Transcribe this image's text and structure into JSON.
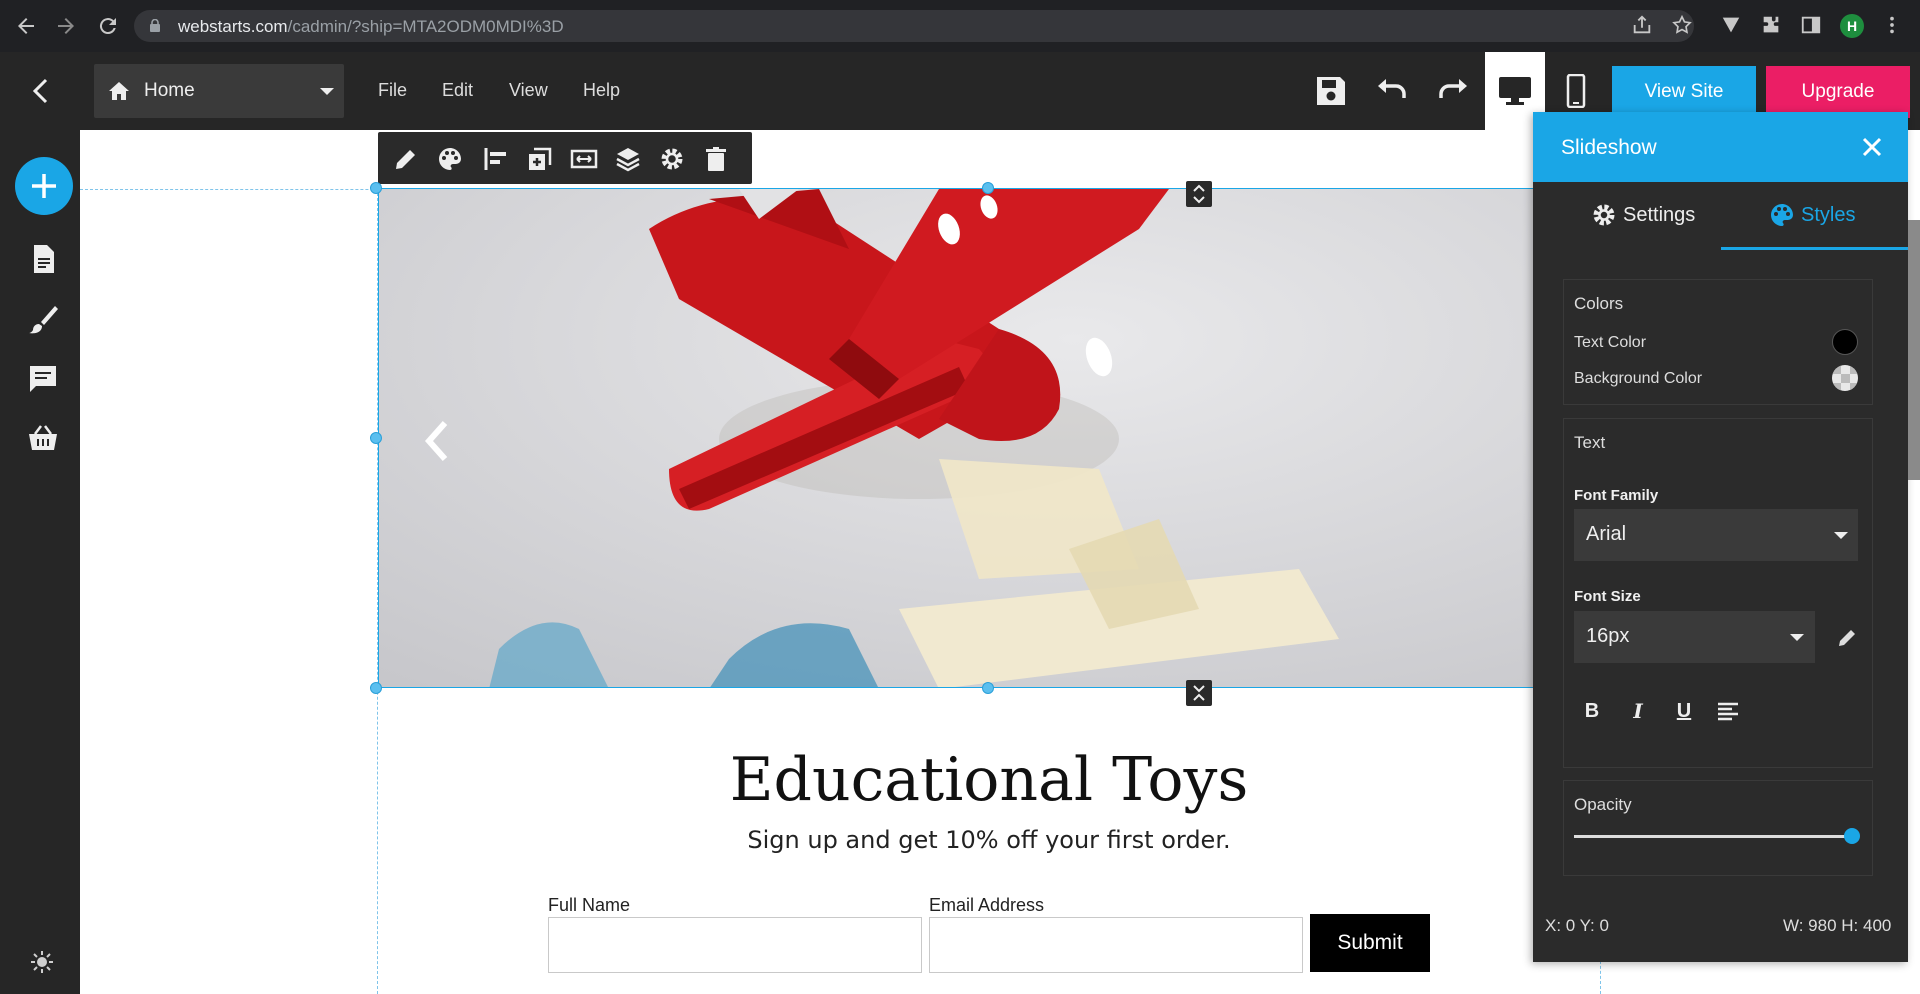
{
  "browser": {
    "url_host": "webstarts.com",
    "url_path": "/cadmin/?ship=MTA2ODM0MDI%3D",
    "avatar_letter": "H"
  },
  "toolbar": {
    "page_select": "Home",
    "menu": [
      "File",
      "Edit",
      "View",
      "Help"
    ],
    "view_site_label": "View Site",
    "upgrade_label": "Upgrade"
  },
  "canvas": {
    "heading": "Educational Toys",
    "subheading": "Sign up and get 10% off your first order.",
    "form": {
      "full_name_label": "Full Name",
      "full_name_value": "",
      "email_label": "Email Address",
      "email_value": "",
      "submit_label": "Submit"
    }
  },
  "panel": {
    "title": "Slideshow",
    "tabs": [
      {
        "label": "Settings",
        "icon": "gear-icon",
        "active": false
      },
      {
        "label": "Styles",
        "icon": "palette-icon",
        "active": true
      }
    ],
    "colors": {
      "title": "Colors",
      "text_color_label": "Text Color",
      "text_color_value": "#000000",
      "background_color_label": "Background Color",
      "background_color_value": "transparent"
    },
    "text": {
      "title": "Text",
      "font_family_label": "Font Family",
      "font_family_value": "Arial",
      "font_size_label": "Font Size",
      "font_size_value": "16px"
    },
    "opacity": {
      "title": "Opacity",
      "value": 1.0
    },
    "position_readout": "X: 0 Y: 0",
    "size_readout": "W: 980 H: 400"
  },
  "colors": {
    "accent": "#1aa6e6",
    "upgrade": "#eb1e65",
    "dark": "#262626"
  }
}
